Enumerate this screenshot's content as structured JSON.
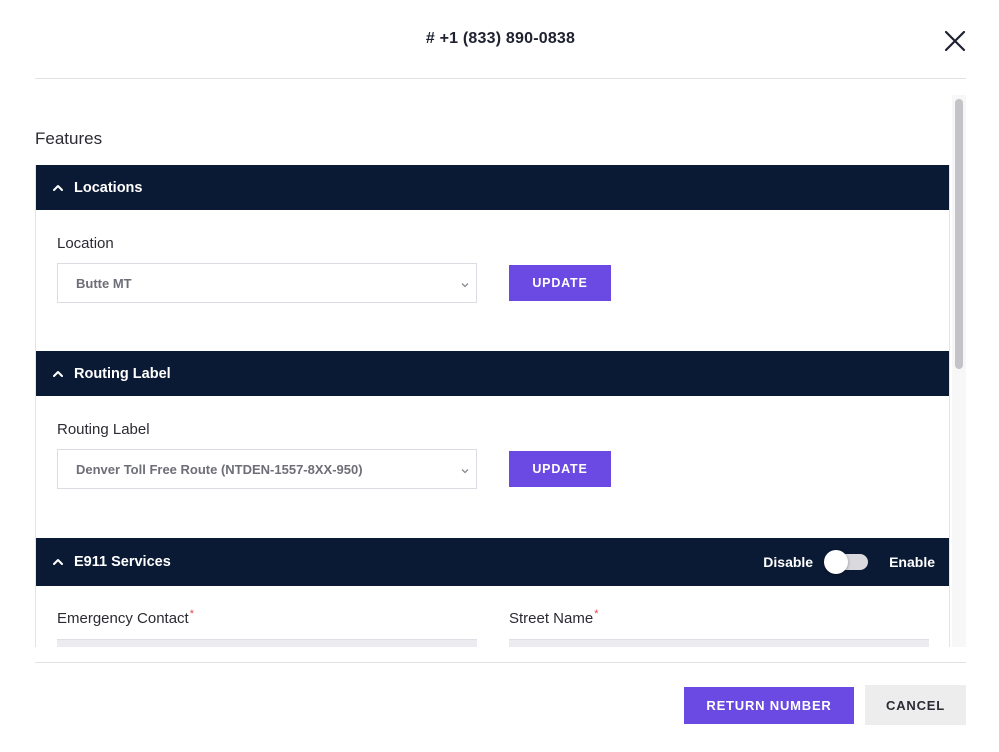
{
  "header": {
    "title": "# +1 (833) 890-0838",
    "close_icon": "close-icon"
  },
  "body": {
    "features_title": "Features",
    "sections": {
      "locations": {
        "title": "Locations",
        "field_label": "Location",
        "select_value": "Butte MT",
        "button_label": "UPDATE"
      },
      "routing": {
        "title": "Routing Label",
        "field_label": "Routing Label",
        "select_value": "Denver Toll Free Route (NTDEN-1557-8XX-950)",
        "button_label": "UPDATE"
      },
      "e911": {
        "title": "E911 Services",
        "toggle_off_label": "Disable",
        "toggle_on_label": "Enable",
        "toggle_state": "off",
        "fields": {
          "emergency_contact_label": "Emergency Contact",
          "street_name_label": "Street Name",
          "required_mark": "*"
        }
      }
    }
  },
  "footer": {
    "return_label": "RETURN NUMBER",
    "cancel_label": "CANCEL"
  },
  "colors": {
    "section_header_bg": "#0b1a34",
    "primary_button": "#6a4ae2",
    "secondary_button": "#ededee",
    "required_mark": "#e5484d"
  }
}
